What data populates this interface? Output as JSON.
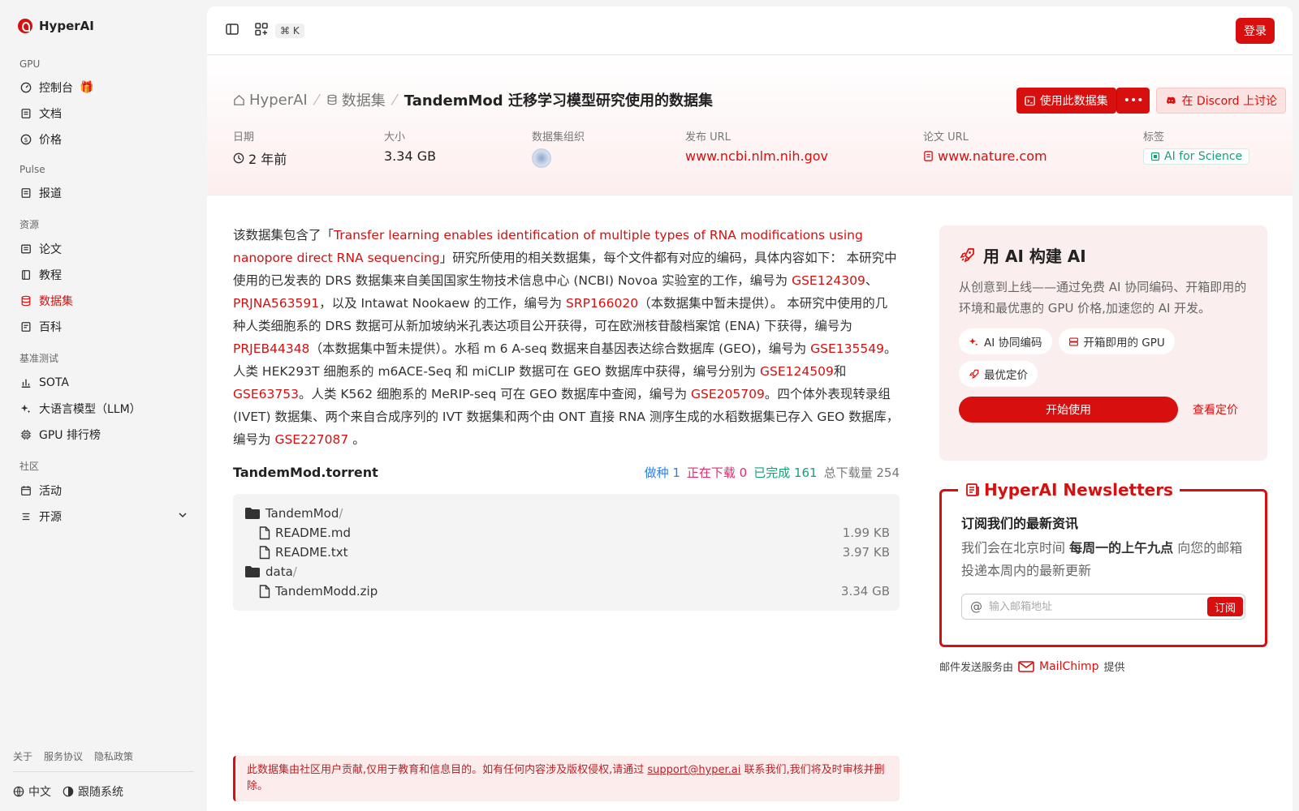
{
  "brand": {
    "name": "HyperAI"
  },
  "sidebar": {
    "groups": [
      {
        "title": "GPU",
        "items": [
          {
            "label": "控制台",
            "icon": "gauge-icon"
          },
          {
            "label": "文档",
            "icon": "doc-icon"
          },
          {
            "label": "价格",
            "icon": "price-icon"
          }
        ]
      },
      {
        "title": "Pulse",
        "items": [
          {
            "label": "报道",
            "icon": "news-icon"
          }
        ]
      },
      {
        "title": "资源",
        "items": [
          {
            "label": "论文",
            "icon": "paper-icon"
          },
          {
            "label": "教程",
            "icon": "book-icon"
          },
          {
            "label": "数据集",
            "icon": "database-icon",
            "active": true
          },
          {
            "label": "百科",
            "icon": "wiki-icon"
          }
        ]
      },
      {
        "title": "基准测试",
        "items": [
          {
            "label": "SOTA",
            "icon": "chart-icon"
          },
          {
            "label": "大语言模型（LLM）",
            "icon": "sparkle-icon"
          },
          {
            "label": "GPU 排行榜",
            "icon": "chip-icon"
          }
        ]
      },
      {
        "title": "社区",
        "items": [
          {
            "label": "活动",
            "icon": "calendar-icon"
          },
          {
            "label": "开源",
            "icon": "list-icon"
          }
        ]
      }
    ],
    "footer_links": [
      "关于",
      "服务协议",
      "隐私政策"
    ],
    "language": "中文",
    "theme": "跟随系统"
  },
  "topbar": {
    "shortcut": "⌘ K",
    "login": "登录"
  },
  "breadcrumb": {
    "home": "HyperAI",
    "section": "数据集",
    "current": "TandemMod 迁移学习模型研究使用的数据集"
  },
  "actions": {
    "use_dataset": "使用此数据集",
    "more": "•••",
    "discord": "在 Discord 上讨论"
  },
  "meta": {
    "date_label": "日期",
    "date_value": "2 年前",
    "size_label": "大小",
    "size_value": "3.34 GB",
    "org_label": "数据集组织",
    "publish_label": "发布 URL",
    "publish_value": "www.ncbi.nlm.nih.gov",
    "paper_label": "论文 URL",
    "paper_value": "www.nature.com",
    "tag_label": "标签",
    "tag_value": "AI for Science"
  },
  "description": {
    "p1": "该数据集包含了「",
    "paper_link": "Transfer learning enables identification of multiple types of RNA modifications using nanopore direct RNA sequencing",
    "p2": "」研究所使用的相关数据集，每个文件都有对应的编码，具体内容如下： 本研究中使用的已发表的 DRS 数据集来自美国国家生物技术信息中心 (NCBI) Novoa 实验室的工作，编号为 ",
    "l1": "GSE124309",
    "p3": "、",
    "l2": "PRJNA563591",
    "p4": "，以及 Intawat Nookaew 的工作，编号为 ",
    "l3": "SRP166020",
    "p5": "（本数据集中暂未提供）。 本研究中使用的几种人类细胞系的 DRS 数据可从新加坡纳米孔表达项目公开获得，可在欧洲核苷酸档案馆 (ENA) 下获得，编号为 ",
    "l4": "PRJEB44348",
    "p6": "（本数据集中暂未提供）。水稻 m 6 A-seq 数据来自基因表达综合数据库 (GEO)，编号为 ",
    "l5": "GSE135549",
    "p7": "。人类 HEK293T 细胞系的 m6ACE-Seq 和 miCLIP 数据可在 GEO 数据库中获得，编号分别为 ",
    "l6": "GSE124509",
    "p8": "和 ",
    "l7": "GSE63753",
    "p9": "。人类 K562 细胞系的 MeRIP-seq 可在 GEO 数据库中查阅，编号为 ",
    "l8": "GSE205709",
    "p10": "。四个体外表现转录组 (IVET) 数据集、两个来自合成序列的 IVT 数据集和两个由 ONT 直接 RNA 测序生成的水稻数据集已存入 GEO 数据库，编号为 ",
    "l9": "GSE227087",
    "p11": " 。"
  },
  "torrent": {
    "title": "TandemMod.torrent",
    "seeding": "做种 1",
    "downloading": "正在下载 0",
    "completed": "已完成 161",
    "total": "总下载量 254",
    "tree": [
      {
        "name": "TandemMod",
        "type": "folder",
        "slash": "/"
      },
      {
        "name": "README.md",
        "type": "file",
        "size": "1.99 KB"
      },
      {
        "name": "README.txt",
        "type": "file",
        "size": "3.97 KB"
      },
      {
        "name": "data",
        "type": "folder",
        "slash": "/"
      },
      {
        "name": "TandemModd.zip",
        "type": "file",
        "size": "3.34 GB"
      }
    ]
  },
  "notice": {
    "text1": "此数据集由社区用户贡献,仅用于教育和信息目的。如有任何内容涉及版权侵权,请通过 ",
    "email": "support@hyper.ai",
    "text2": " 联系我们,我们将及时审核并删除。"
  },
  "ai_card": {
    "title": "用 AI 构建 AI",
    "desc": "从创意到上线——通过免费 AI 协同编码、开箱即用的环境和最优惠的 GPU 价格,加速您的 AI 开发。",
    "chips": [
      "AI 协同编码",
      "开箱即用的 GPU",
      "最优定价"
    ],
    "start": "开始使用",
    "pricing": "查看定价"
  },
  "newsletter": {
    "legend": "HyperAI Newsletters",
    "title": "订阅我们的最新资讯",
    "desc1": "我们会在北京时间 ",
    "desc_bold": "每周一的上午九点",
    "desc2": " 向您的邮箱投递本周内的最新更新",
    "placeholder": "输入邮箱地址",
    "subscribe": "订阅",
    "note": "邮件发送服务由",
    "provider": "MailChimp",
    "note_end": "提供"
  },
  "colors": {
    "accent": "#d70f0f",
    "seed": "#2f7fea",
    "down": "#e52d6a",
    "done": "#16a07a"
  }
}
